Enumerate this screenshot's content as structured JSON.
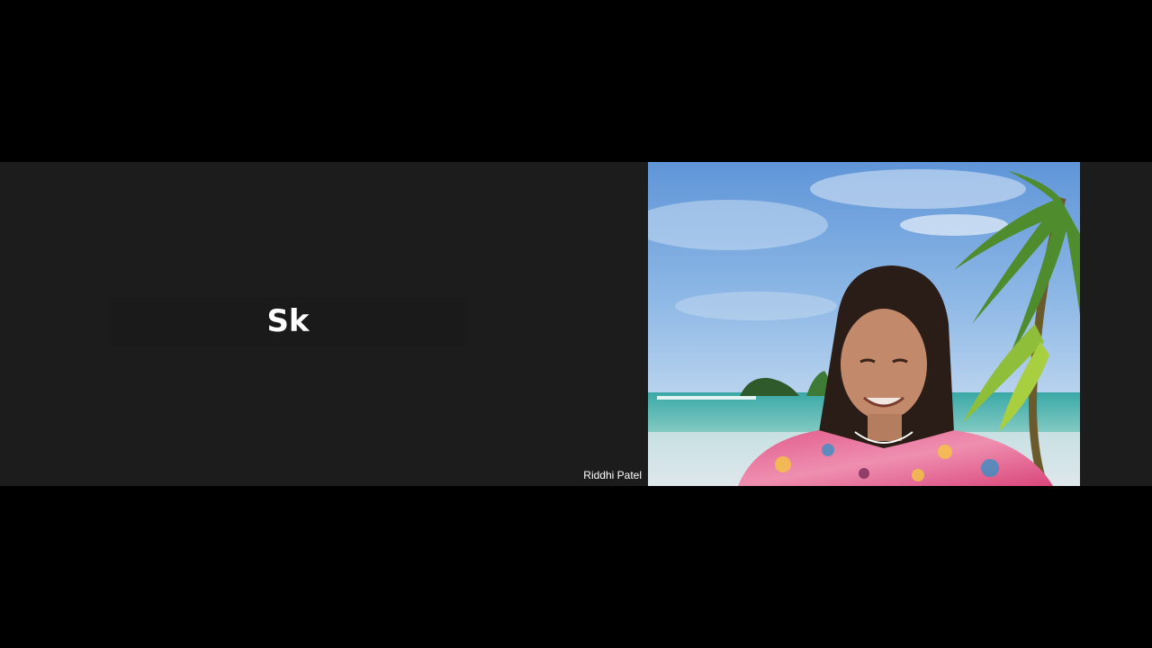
{
  "meeting": {
    "participants": [
      {
        "initials": "Sk",
        "name": "Riddhi Patel",
        "video": "off"
      },
      {
        "name": "",
        "video": "on",
        "background": "tropical-beach"
      }
    ]
  },
  "colors": {
    "page_background": "#000000",
    "tile_background": "#1c1c1c",
    "label_text": "#ffffff"
  }
}
